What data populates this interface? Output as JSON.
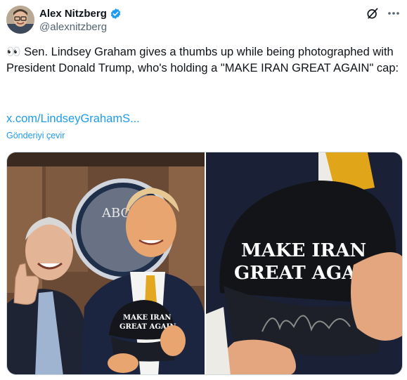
{
  "author": {
    "display_name": "Alex Nitzberg",
    "handle": "@alexnitzberg"
  },
  "tweet": {
    "text": "👀 Sen. Lindsey Graham gives a thumbs up while being photographed with President Donald Trump, who's holding a \"MAKE IRAN GREAT AGAIN\" cap:",
    "link": "x.com/LindseyGrahamS...",
    "translate_label": "Gönderiyi çevir"
  },
  "media": {
    "left_sign_text": "ABC",
    "cap_text_left": [
      "MAKE IRAN",
      "GREAT AGAIN"
    ],
    "cap_text_right": [
      "MAKE IRAN",
      "GREAT AGAIN"
    ]
  },
  "colors": {
    "verified": "#1d9bf0",
    "link": "#1d9bf0",
    "secondary_text": "#536471"
  },
  "icons": {
    "verified": "verified-badge-icon",
    "grok": "grok-icon",
    "more": "more-icon"
  }
}
